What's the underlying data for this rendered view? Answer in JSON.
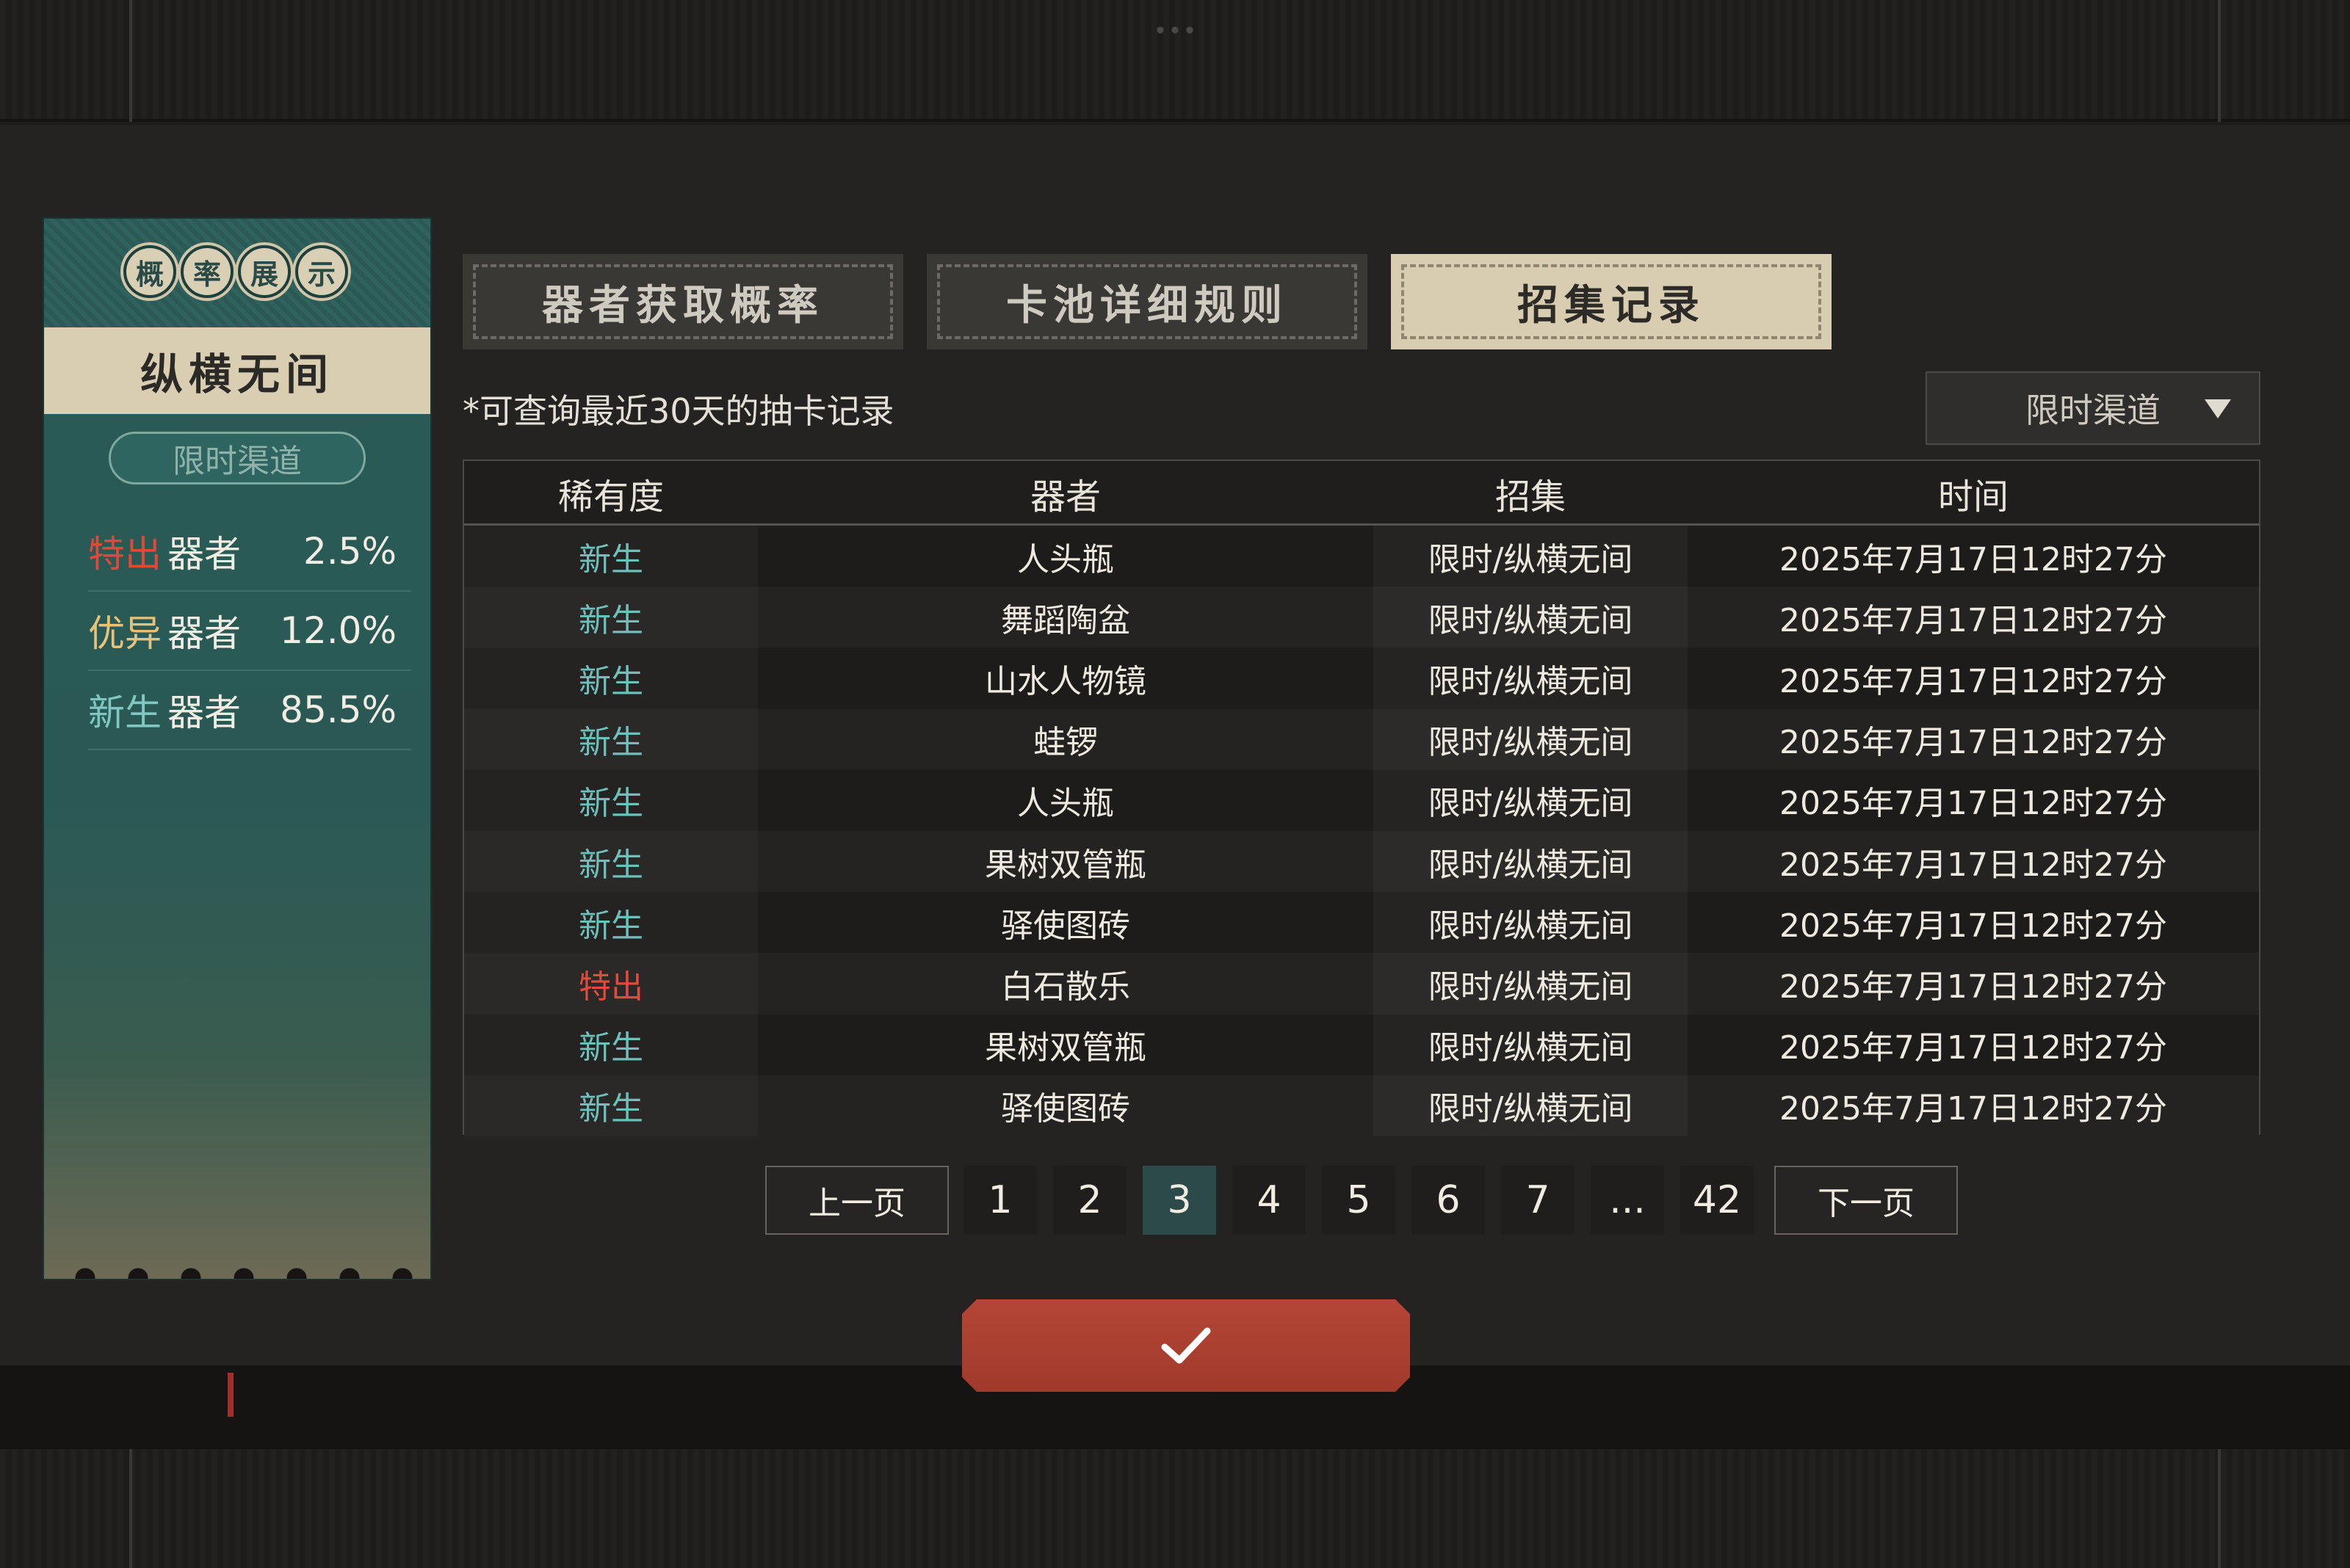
{
  "prob_panel": {
    "badges": [
      "概",
      "率",
      "展",
      "示"
    ],
    "title": "纵横无间",
    "channel": "限时渠道",
    "rows": [
      {
        "rarity": "特出",
        "rarity_color": "#e0483a",
        "kind": "器者",
        "percent": "2.5%"
      },
      {
        "rarity": "优异",
        "rarity_color": "#e9c27a",
        "kind": "器者",
        "percent": "12.0%"
      },
      {
        "rarity": "新生",
        "rarity_color": "#7fc7c1",
        "kind": "器者",
        "percent": "85.5%"
      }
    ]
  },
  "tabs": [
    {
      "label": "器者获取概率",
      "active": false
    },
    {
      "label": "卡池详细规则",
      "active": false
    },
    {
      "label": "招集记录",
      "active": true
    }
  ],
  "note": "*可查询最近30天的抽卡记录",
  "channel_select": {
    "value": "限时渠道",
    "icon": "triangle-down-icon"
  },
  "table": {
    "headers": [
      "稀有度",
      "器者",
      "招集",
      "时间"
    ],
    "rows": [
      {
        "rarity": "新生",
        "rarity_color": "#6ec1bb",
        "item": "人头瓶",
        "pool": "限时/纵横无间",
        "time": "2025年7月17日12时27分"
      },
      {
        "rarity": "新生",
        "rarity_color": "#6ec1bb",
        "item": "舞蹈陶盆",
        "pool": "限时/纵横无间",
        "time": "2025年7月17日12时27分"
      },
      {
        "rarity": "新生",
        "rarity_color": "#6ec1bb",
        "item": "山水人物镜",
        "pool": "限时/纵横无间",
        "time": "2025年7月17日12时27分"
      },
      {
        "rarity": "新生",
        "rarity_color": "#6ec1bb",
        "item": "蛙锣",
        "pool": "限时/纵横无间",
        "time": "2025年7月17日12时27分"
      },
      {
        "rarity": "新生",
        "rarity_color": "#6ec1bb",
        "item": "人头瓶",
        "pool": "限时/纵横无间",
        "time": "2025年7月17日12时27分"
      },
      {
        "rarity": "新生",
        "rarity_color": "#6ec1bb",
        "item": "果树双管瓶",
        "pool": "限时/纵横无间",
        "time": "2025年7月17日12时27分"
      },
      {
        "rarity": "新生",
        "rarity_color": "#6ec1bb",
        "item": "驿使图砖",
        "pool": "限时/纵横无间",
        "time": "2025年7月17日12时27分"
      },
      {
        "rarity": "特出",
        "rarity_color": "#e04b3c",
        "item": "白石散乐",
        "pool": "限时/纵横无间",
        "time": "2025年7月17日12时27分"
      },
      {
        "rarity": "新生",
        "rarity_color": "#6ec1bb",
        "item": "果树双管瓶",
        "pool": "限时/纵横无间",
        "time": "2025年7月17日12时27分"
      },
      {
        "rarity": "新生",
        "rarity_color": "#6ec1bb",
        "item": "驿使图砖",
        "pool": "限时/纵横无间",
        "time": "2025年7月17日12时27分"
      }
    ]
  },
  "pagination": {
    "prev_label": "上一页",
    "next_label": "下一页",
    "pages": [
      "1",
      "2",
      "3",
      "4",
      "5",
      "6",
      "7",
      "...",
      "42"
    ],
    "current": "3"
  },
  "confirm": {
    "icon": "checkmark-icon"
  },
  "colors": {
    "accent_teal": "#2b5b57",
    "confirm_red": "#b44636"
  }
}
